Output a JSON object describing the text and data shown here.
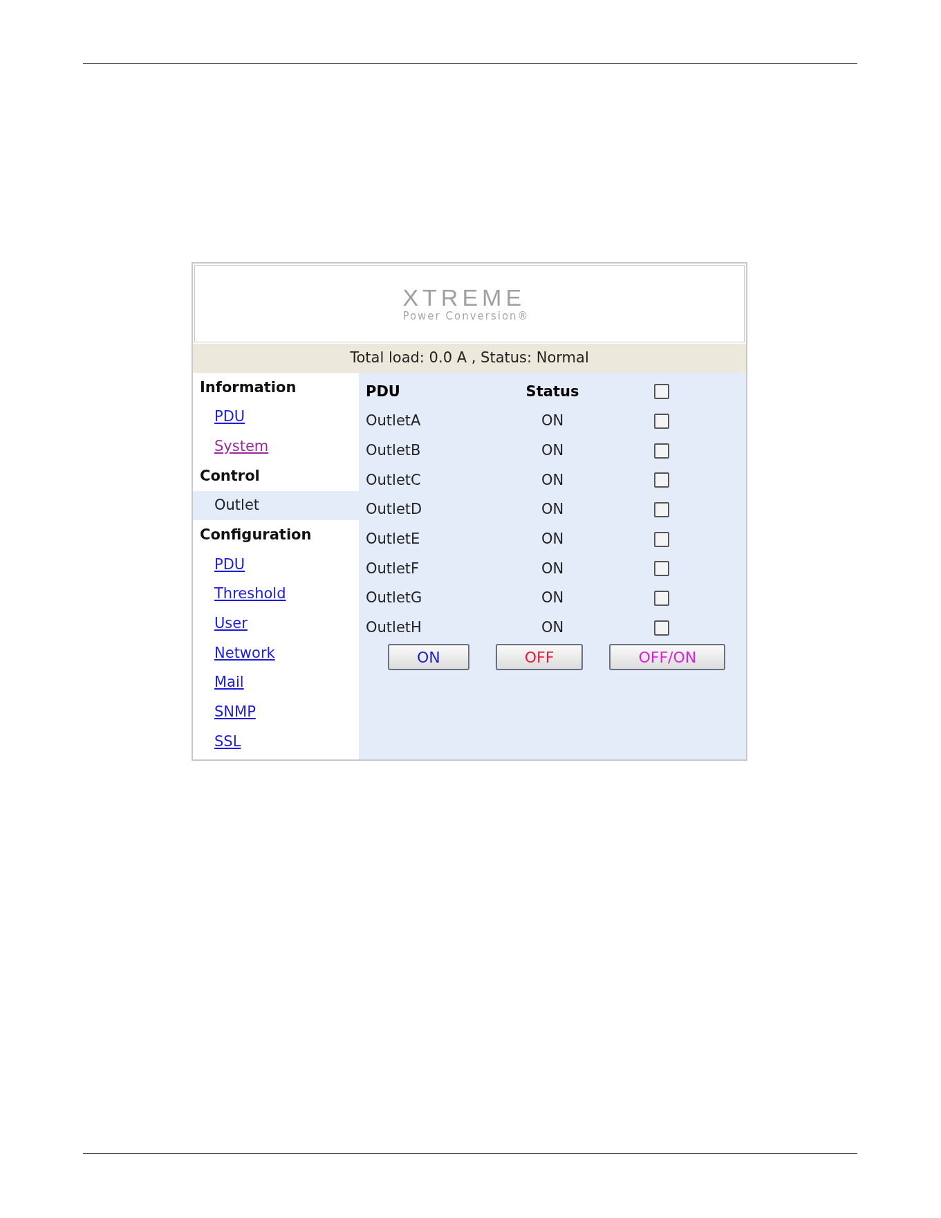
{
  "logo": {
    "wordmark": "XTREME",
    "tagline": "Power Conversion®"
  },
  "status_bar": {
    "text": "Total load: 0.0 A , Status: Normal"
  },
  "sidebar": {
    "sections": [
      {
        "title": "Information",
        "items": [
          {
            "label": "PDU",
            "selected": false,
            "visited": false
          },
          {
            "label": "System",
            "selected": false,
            "visited": true
          }
        ]
      },
      {
        "title": "Control",
        "items": [
          {
            "label": "Outlet",
            "selected": true,
            "visited": false
          }
        ]
      },
      {
        "title": "Configuration",
        "items": [
          {
            "label": "PDU",
            "selected": false,
            "visited": false
          },
          {
            "label": "Threshold",
            "selected": false,
            "visited": false
          },
          {
            "label": "User",
            "selected": false,
            "visited": false
          },
          {
            "label": "Network",
            "selected": false,
            "visited": false
          },
          {
            "label": "Mail",
            "selected": false,
            "visited": false
          },
          {
            "label": "SNMP",
            "selected": false,
            "visited": false
          },
          {
            "label": "SSL",
            "selected": false,
            "visited": false
          }
        ]
      }
    ]
  },
  "table": {
    "columns": [
      "PDU",
      "Status"
    ],
    "select_all": {
      "checked": false
    },
    "rows": [
      {
        "name": "OutletA",
        "status": "ON",
        "checked": false
      },
      {
        "name": "OutletB",
        "status": "ON",
        "checked": false
      },
      {
        "name": "OutletC",
        "status": "ON",
        "checked": false
      },
      {
        "name": "OutletD",
        "status": "ON",
        "checked": false
      },
      {
        "name": "OutletE",
        "status": "ON",
        "checked": false
      },
      {
        "name": "OutletF",
        "status": "ON",
        "checked": false
      },
      {
        "name": "OutletG",
        "status": "ON",
        "checked": false
      },
      {
        "name": "OutletH",
        "status": "ON",
        "checked": false
      }
    ]
  },
  "buttons": [
    {
      "label": "ON",
      "color": "#1c1ccc"
    },
    {
      "label": "OFF",
      "color": "#e0203a"
    },
    {
      "label": "OFF/ON",
      "color": "#e020d8"
    }
  ]
}
